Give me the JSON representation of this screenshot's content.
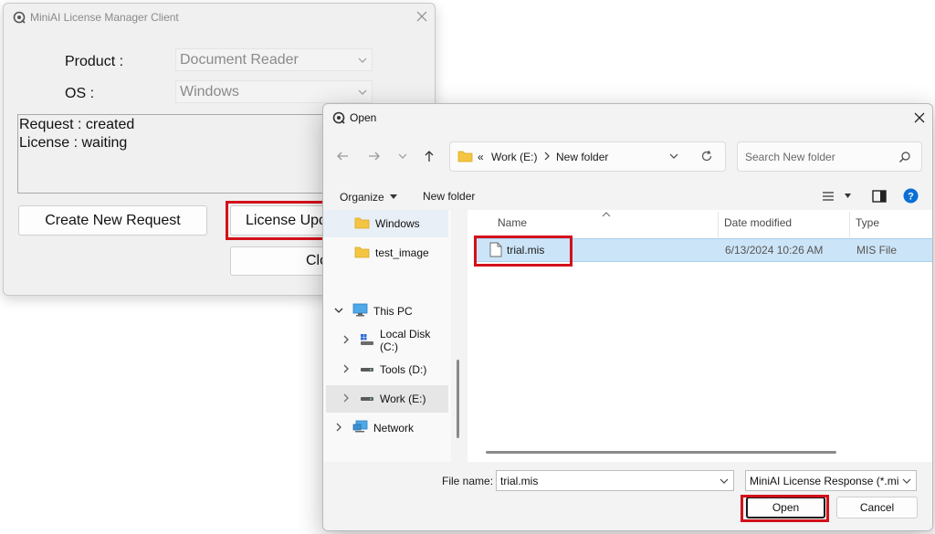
{
  "main_window": {
    "title": "MiniAI License Manager Client",
    "product_label": "Product :",
    "product_value": "Document Reader",
    "os_label": "OS :",
    "os_value": "Windows",
    "status_lines": [
      "Request : created",
      "License : waiting"
    ],
    "create_request_label": "Create New Request",
    "license_update_label": "License Upd",
    "close_label": "Clo"
  },
  "dialog": {
    "title": "Open",
    "breadcrumb": {
      "overflow": "«",
      "segments": [
        "Work (E:)",
        "New folder"
      ]
    },
    "search_placeholder": "Search New folder",
    "organize_label": "Organize",
    "new_folder_label": "New folder",
    "nav_items": [
      {
        "label": "Windows",
        "icon": "folder-icon"
      },
      {
        "label": "test_image",
        "icon": "folder-icon"
      },
      {
        "label": "This PC",
        "icon": "pc-icon"
      },
      {
        "label": "Local Disk (C:)",
        "icon": "windows-drive-icon"
      },
      {
        "label": "Tools (D:)",
        "icon": "drive-icon"
      },
      {
        "label": "Work (E:)",
        "icon": "drive-icon"
      },
      {
        "label": "Network",
        "icon": "network-icon"
      }
    ],
    "columns": [
      "Name",
      "Date modified",
      "Type"
    ],
    "files": [
      {
        "name": "trial.mis",
        "date": "6/13/2024 10:26 AM",
        "type": "MIS File"
      }
    ],
    "file_name_label": "File name:",
    "file_name_value": "trial.mis",
    "file_type_value": "MiniAI License Response (*.mis",
    "open_label": "Open",
    "cancel_label": "Cancel"
  },
  "colors": {
    "highlight": "#d3111b",
    "selection": "#cce4f7",
    "folder": "#f4c542",
    "help": "#0a6fd6"
  }
}
